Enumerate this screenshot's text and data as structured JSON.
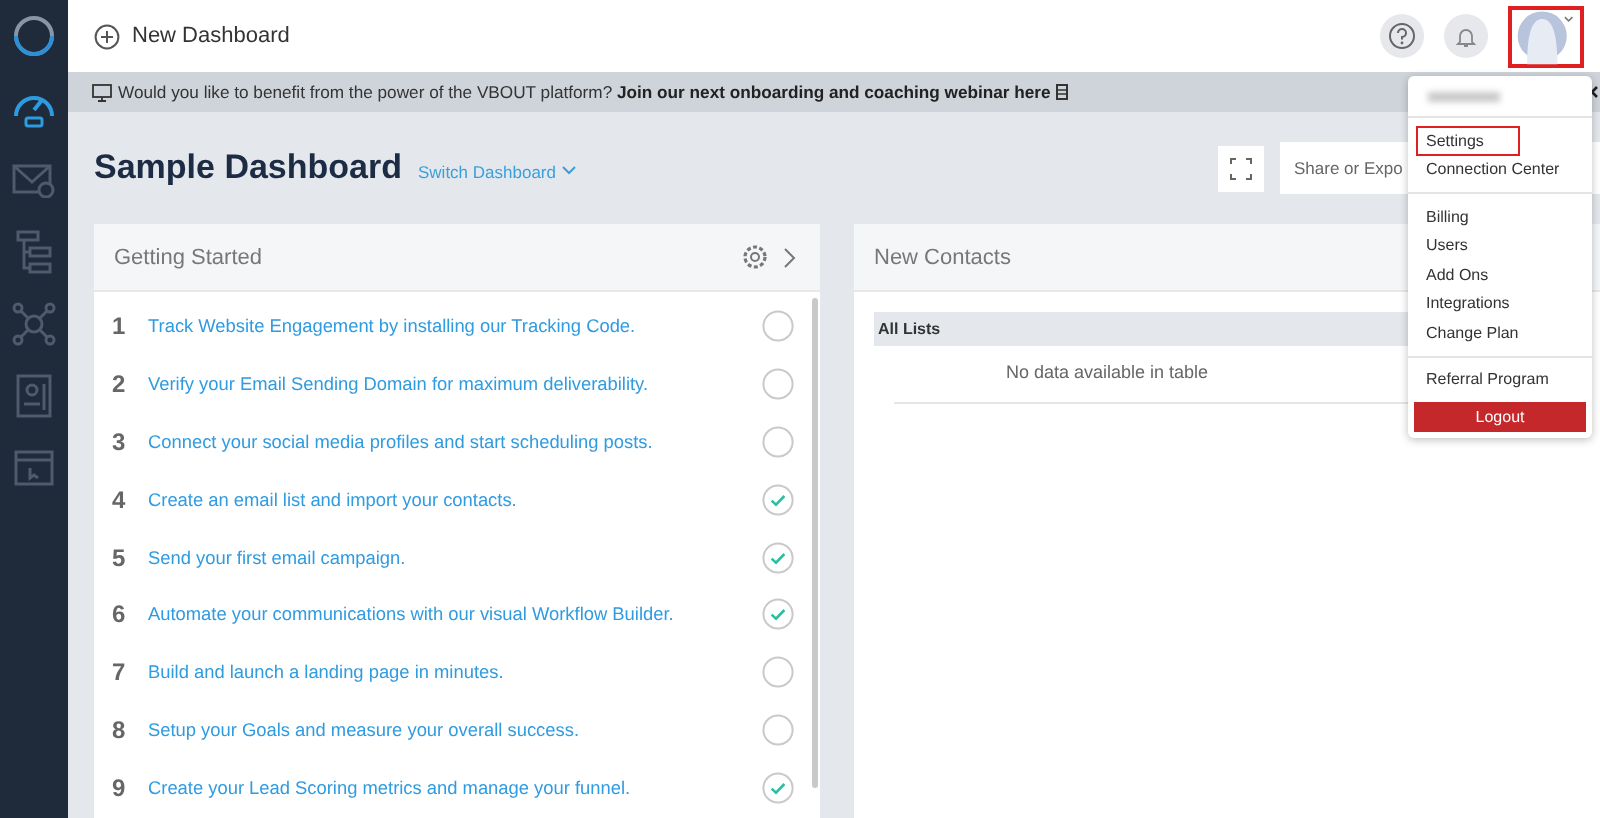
{
  "sidebar": {
    "items": [
      {
        "kind": "dashboard",
        "selected": true
      },
      {
        "kind": "mail",
        "selected": false
      },
      {
        "kind": "hierarchy",
        "selected": false
      },
      {
        "kind": "network",
        "selected": false
      },
      {
        "kind": "document",
        "selected": false
      },
      {
        "kind": "browser",
        "selected": false
      }
    ]
  },
  "topbar": {
    "new_dashboard": "New Dashboard",
    "avatar_highlighted": true
  },
  "banner": {
    "text": "Would you like to benefit from the power of the VBOUT platform? **Join our next onboarding and coaching webinar here**"
  },
  "page": {
    "title": "Sample Dashboard",
    "switch": "Switch Dashboard",
    "share": "Share or Expo"
  },
  "getting_started": {
    "title": "Getting Started",
    "items": [
      {
        "number": "1",
        "text": "Track Website Engagement by installing our Tracking Code.",
        "checked": false
      },
      {
        "number": "2",
        "text": "Verify your Email Sending Domain for maximum deliverability.",
        "checked": false
      },
      {
        "number": "3",
        "text": "Connect your social media profiles and start scheduling posts.",
        "checked": false
      },
      {
        "number": "4",
        "text": "Create an email list and import your contacts.",
        "checked": true
      },
      {
        "number": "5",
        "text": "Send your first email campaign.",
        "checked": true
      },
      {
        "number": "6",
        "text": "Automate your communications with our visual Workflow Builder.",
        "checked": true
      },
      {
        "number": "7",
        "text": "Build and launch a landing page in minutes.",
        "checked": false
      },
      {
        "number": "8",
        "text": "Setup your Goals and measure your overall success.",
        "checked": false
      },
      {
        "number": "9",
        "text": "Create your Lead Scoring metrics and manage your funnel.",
        "checked": true
      }
    ]
  },
  "new_contacts": {
    "title": "New Contacts",
    "column_1": "All Lists",
    "empty": "No data available in table"
  },
  "user_menu": {
    "groups": [
      [
        {
          "label": "Settings",
          "highlighted": true
        },
        {
          "label": "Connection Center",
          "highlighted": false
        }
      ],
      [
        {
          "label": "Billing",
          "highlighted": false
        },
        {
          "label": "Users",
          "highlighted": false
        },
        {
          "label": "Add Ons",
          "highlighted": false
        },
        {
          "label": "Integrations",
          "highlighted": false
        },
        {
          "label": "Change Plan",
          "highlighted": false
        }
      ],
      [
        {
          "label": "Referral Program",
          "highlighted": false
        }
      ]
    ],
    "logout": "Logout"
  }
}
